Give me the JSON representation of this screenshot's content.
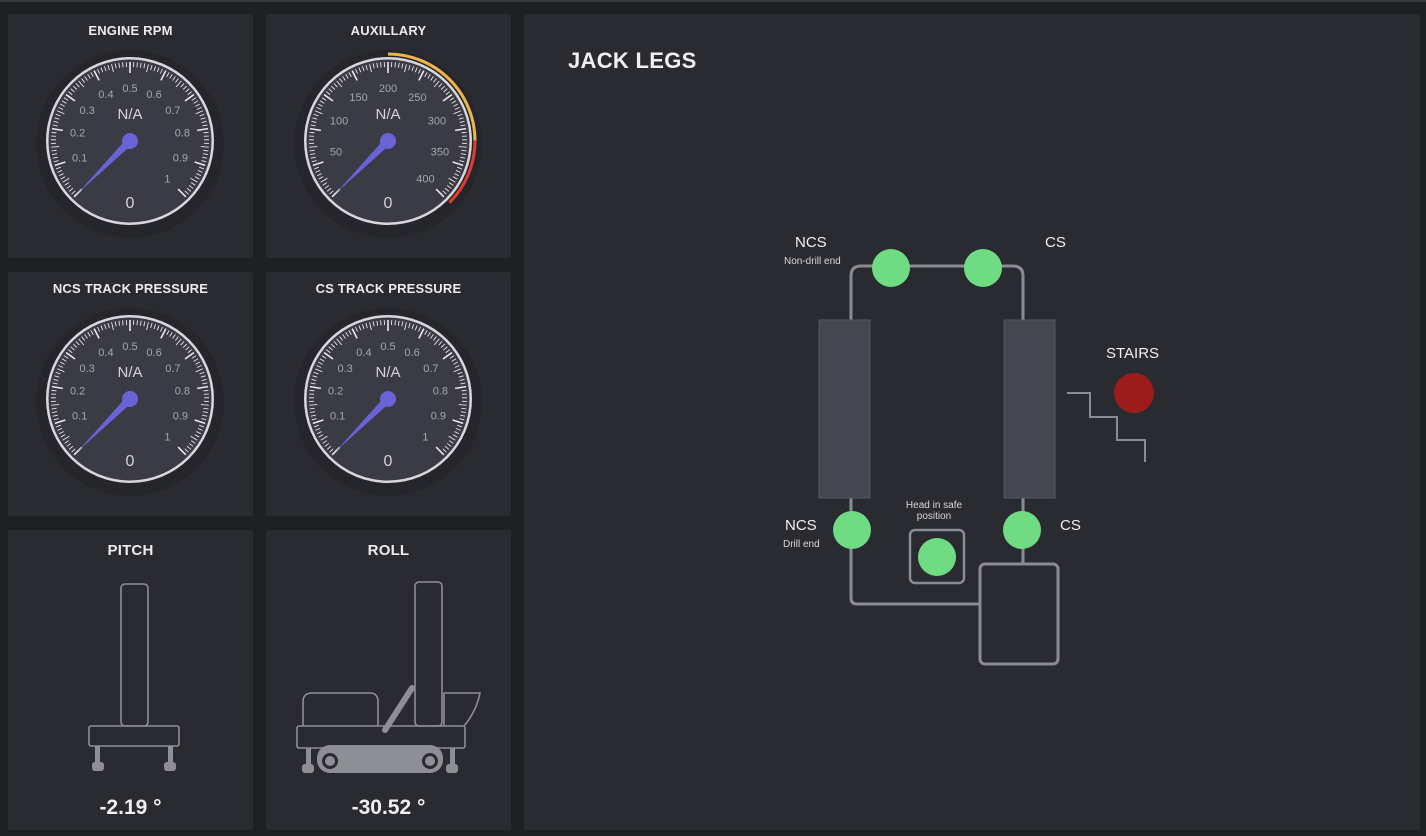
{
  "gauges": [
    {
      "title": "ENGINE RPM",
      "center_text": "N/A",
      "value_text": "0",
      "min": 0,
      "max": 1,
      "value": 0,
      "labels": [
        "0.1",
        "0.2",
        "0.3",
        "0.4",
        "0.5",
        "0.6",
        "0.7",
        "0.8",
        "0.9",
        "1"
      ],
      "zones": []
    },
    {
      "title": "AUXILLARY",
      "center_text": "N/A",
      "value_text": "0",
      "min": 0,
      "max": 400,
      "value": 0,
      "labels": [
        "50",
        "100",
        "150",
        "200",
        "250",
        "300",
        "350",
        "400"
      ],
      "zones": [
        {
          "from": 200,
          "to": 333,
          "color": "#f0b44a"
        },
        {
          "from": 333,
          "to": 400,
          "color": "#e53935"
        }
      ]
    },
    {
      "title": "NCS TRACK PRESSURE",
      "center_text": "N/A",
      "value_text": "0",
      "min": 0,
      "max": 1,
      "value": 0,
      "labels": [
        "0.1",
        "0.2",
        "0.3",
        "0.4",
        "0.5",
        "0.6",
        "0.7",
        "0.8",
        "0.9",
        "1"
      ],
      "zones": []
    },
    {
      "title": "CS TRACK PRESSURE",
      "center_text": "N/A",
      "value_text": "0",
      "min": 0,
      "max": 1,
      "value": 0,
      "labels": [
        "0.1",
        "0.2",
        "0.3",
        "0.4",
        "0.5",
        "0.6",
        "0.7",
        "0.8",
        "0.9",
        "1"
      ],
      "zones": []
    }
  ],
  "pitch": {
    "title": "PITCH",
    "value": "-2.19 °"
  },
  "roll": {
    "title": "ROLL",
    "value": "-30.52 °"
  },
  "jack_legs": {
    "title": "JACK LEGS",
    "ncs_top": "NCS",
    "ncs_top_sub": "Non-drill end",
    "cs_top": "CS",
    "stairs": "STAIRS",
    "ncs_bottom": "NCS",
    "ncs_bottom_sub": "Drill end",
    "cs_bottom": "CS",
    "head_safe": "Head in safe position",
    "status": {
      "ncs_top": "ok",
      "cs_top": "ok",
      "ncs_bottom": "ok",
      "cs_bottom": "ok",
      "head_safe": "ok",
      "stairs": "alarm"
    }
  },
  "colors": {
    "ok": "#6fdc83",
    "alarm": "#9c1c1c",
    "needle": "#6a63d6",
    "panel": "#2a2b30",
    "line": "#8b8b92"
  }
}
